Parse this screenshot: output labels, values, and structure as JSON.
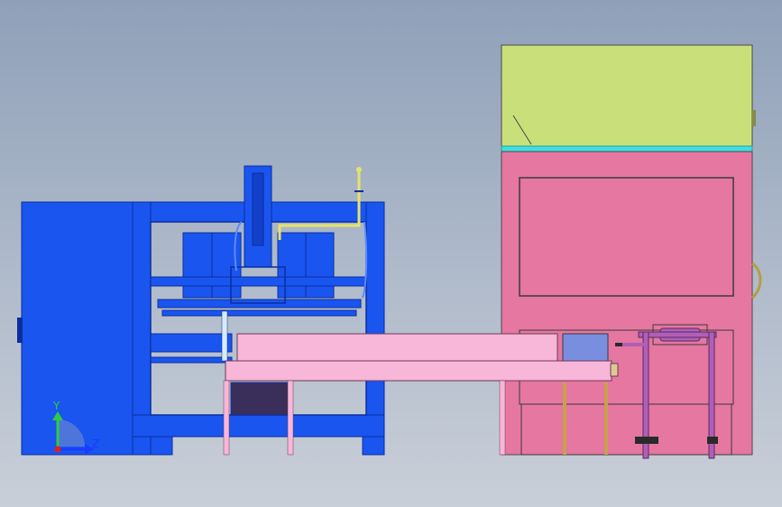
{
  "view": {
    "background_top": "#8fa0b8",
    "background_bottom": "#c9cfd8"
  },
  "triad": {
    "y_label": "Y",
    "z_label": "Z",
    "y_color": "#2ecc40",
    "z_color": "#1a3cff",
    "origin_color": "#e0201a"
  },
  "colors": {
    "machine_blue": "#1a55f0",
    "machine_blue_dark": "#0b2e9e",
    "hopper_green": "#c9e07a",
    "cyan_strip": "#3de0e0",
    "cabinet_pink": "#e577a0",
    "conveyor_pink": "#f8b6d8",
    "pin_purple": "#b05fb8",
    "tray_dark": "#3a2f5a",
    "tan_leg": "#c8a050",
    "lavender_box": "#7a8ee0"
  }
}
